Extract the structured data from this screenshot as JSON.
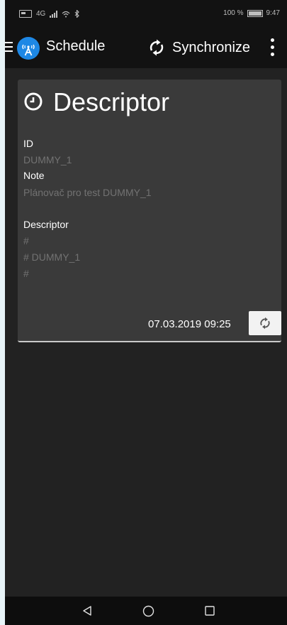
{
  "status_bar": {
    "network_label": "4G",
    "battery_percent": "100 %",
    "time": "9:47"
  },
  "app_bar": {
    "title": "Schedule",
    "sync_label": "Synchronize",
    "icons": [
      "menu-icon",
      "app-logo-icon",
      "sync-icon",
      "overflow-icon"
    ]
  },
  "card": {
    "title": "Descriptor",
    "icon": "clock-icon",
    "fields": {
      "id_label": "ID",
      "id_value": "DUMMY_1",
      "note_label": "Note",
      "note_value": "Plánovač pro test DUMMY_1",
      "descriptor_label": "Descriptor",
      "descriptor_lines": [
        "#",
        "# DUMMY_1",
        "#"
      ]
    },
    "date": "07.03.2019 09:25",
    "sync_button_icon": "sync-icon"
  },
  "nav_bar": {
    "icons": [
      "back-icon",
      "home-icon",
      "recent-apps-icon"
    ]
  },
  "colors": {
    "background": "#222222",
    "app_bar": "#121212",
    "card": "#3a3a3a",
    "muted_text": "#727272",
    "logo_blue": "#1e88e5"
  }
}
